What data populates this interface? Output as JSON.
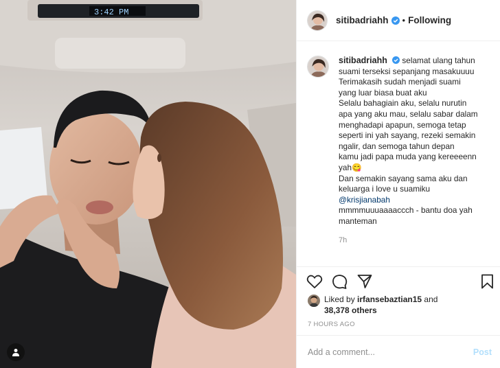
{
  "photo": {
    "car_display_text": "3:42 PM ",
    "tag_icon": "user-tag-icon"
  },
  "header": {
    "username": "sitibadriahh",
    "separator": "•",
    "follow_status": "Following",
    "verified_icon": "verified-badge-icon"
  },
  "caption": {
    "username": "sitibadriahh",
    "lines": [
      "selamat ulang tahun",
      "suami terseksi sepanjang masakuuuu",
      "Terimakasih sudah menjadi suami",
      "yang luar biasa buat aku",
      "Selalu bahagiain aku, selalu nurutin",
      "apa yang aku mau, selalu sabar dalam",
      "menghadapi apapun, semoga tetap",
      "seperti ini yah sayang, rezeki semakin",
      "ngalir, dan semoga tahun depan",
      "kamu jadi papa muda yang kereeeenn",
      "yah😋",
      "Dan semakin sayang sama aku dan",
      "keluarga i love u suamiku"
    ],
    "mention": "@krisjianabah",
    "tail_lines": [
      "mmmmuuuaaaaccch - bantu doa yah",
      "manteman"
    ],
    "time": "7h"
  },
  "actions": {
    "like_icon": "heart-icon",
    "comment_icon": "comment-icon",
    "share_icon": "share-icon",
    "save_icon": "bookmark-icon"
  },
  "likes": {
    "prefix": "Liked by ",
    "user": "irfansebaztian15",
    "joiner": " and",
    "count": "38,378 others"
  },
  "posted_ago": "7 HOURS AGO",
  "comment_box": {
    "placeholder": "Add a comment...",
    "post_label": "Post"
  },
  "colors": {
    "verified_blue": "#3897f0",
    "mention_blue": "#00376b",
    "post_disabled": "#b2dffc",
    "muted_text": "#8e8e8e"
  }
}
